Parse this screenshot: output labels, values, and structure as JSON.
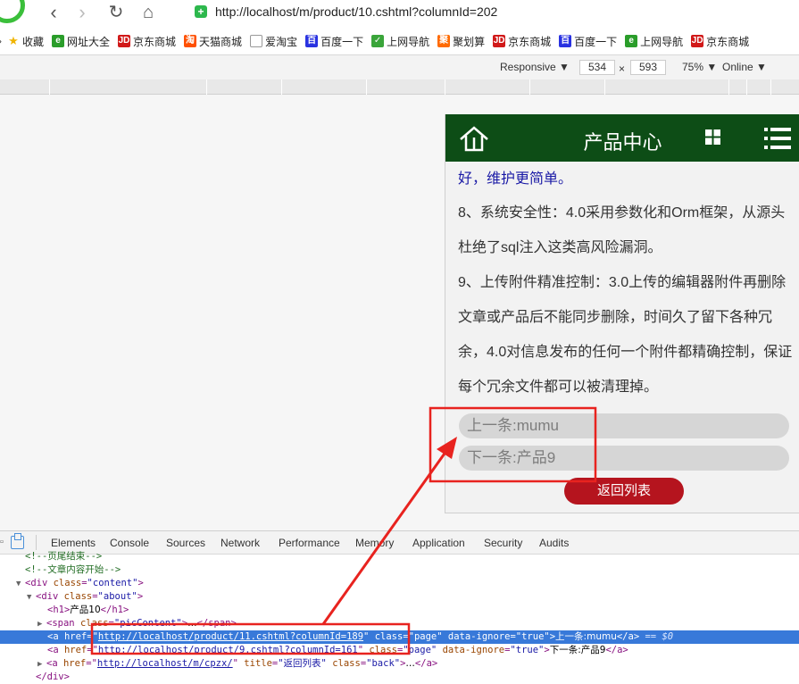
{
  "browser": {
    "url": "http://localhost/m/product/10.cshtml?columnId=202",
    "back_glyph": "‹",
    "forward_glyph": "›",
    "reload_glyph": "↻",
    "home_glyph": "⌂",
    "bookmarks": [
      {
        "label": "收藏",
        "icon_text": "★",
        "color": "#f0b400"
      },
      {
        "label": "网址大全",
        "icon_text": "e",
        "color": "#2a9d2a"
      },
      {
        "label": "京东商城",
        "icon_text": "JD",
        "color": "#d11919"
      },
      {
        "label": "天猫商城",
        "icon_text": "淘",
        "color": "#ff5000"
      },
      {
        "label": "爱淘宝",
        "icon_text": "",
        "color": "#999999"
      },
      {
        "label": "百度一下",
        "icon_text": "百",
        "color": "#2932e1"
      },
      {
        "label": "上网导航",
        "icon_text": "✓",
        "color": "#3aa53a"
      },
      {
        "label": "聚划算",
        "icon_text": "聚",
        "color": "#ff6a00"
      },
      {
        "label": "京东商城",
        "icon_text": "JD",
        "color": "#d11919"
      },
      {
        "label": "百度一下",
        "icon_text": "百",
        "color": "#2932e1"
      },
      {
        "label": "上网导航",
        "icon_text": "e",
        "color": "#2a9d2a"
      },
      {
        "label": "京东商城",
        "icon_text": "JD",
        "color": "#d11919"
      }
    ]
  },
  "device_toolbar": {
    "mode": "Responsive ▼",
    "width": "534",
    "times": "×",
    "height": "593",
    "zoom": "75% ▼",
    "network": "Online ▼"
  },
  "mobile": {
    "header_title": "产品中心",
    "article": {
      "line_top": "好，维护更简单。",
      "para8": "8、系统安全性：4.0采用参数化和Orm框架，从源头杜绝了sql注入这类高风险漏洞。",
      "para9": "9、上传附件精准控制：3.0上传的编辑器附件再删除文章或产品后不能同步删除，时间久了留下各种冗余，4.0对信息发布的任何一个附件都精确控制，保证每个冗余文件都可以被清理掉。"
    },
    "prev_link": "上一条:mumu",
    "next_link": "下一条:产品9",
    "back_button": "返回列表",
    "colors": {
      "header": "#0d4d16",
      "back_button": "#b5141e"
    }
  },
  "devtools": {
    "tabs": [
      "Elements",
      "Console",
      "Sources",
      "Network",
      "Performance",
      "Memory",
      "Application",
      "Security",
      "Audits"
    ],
    "code": {
      "c1": "<!--页尾结束-->",
      "c2": "<!--文章内容开始-->",
      "div_content_open": "<div ",
      "class_attr": "class",
      "content_val": "\"content\"",
      "about_val": "\"about\"",
      "h1_text": "产品10",
      "span_class_val": "\"picContent\"",
      "href1": "http://localhost/product/11.cshtml?columnId=189",
      "href2": "http://localhost/product/9.cshtml?columnId=161",
      "href3": "http://localhost/m/cpzx/",
      "page_val": "\"page\"",
      "ignore_attr": "data-ignore",
      "true_val": "\"true\"",
      "link1_text": "上一条:mumu",
      "link2_text": "下一条:产品9",
      "title_attr": "title",
      "title_val": "\"返回列表\"",
      "back_val": "\"back\"",
      "sel_hint": "== $0",
      "ellipsis": "…",
      "div_close": "</div>"
    }
  }
}
